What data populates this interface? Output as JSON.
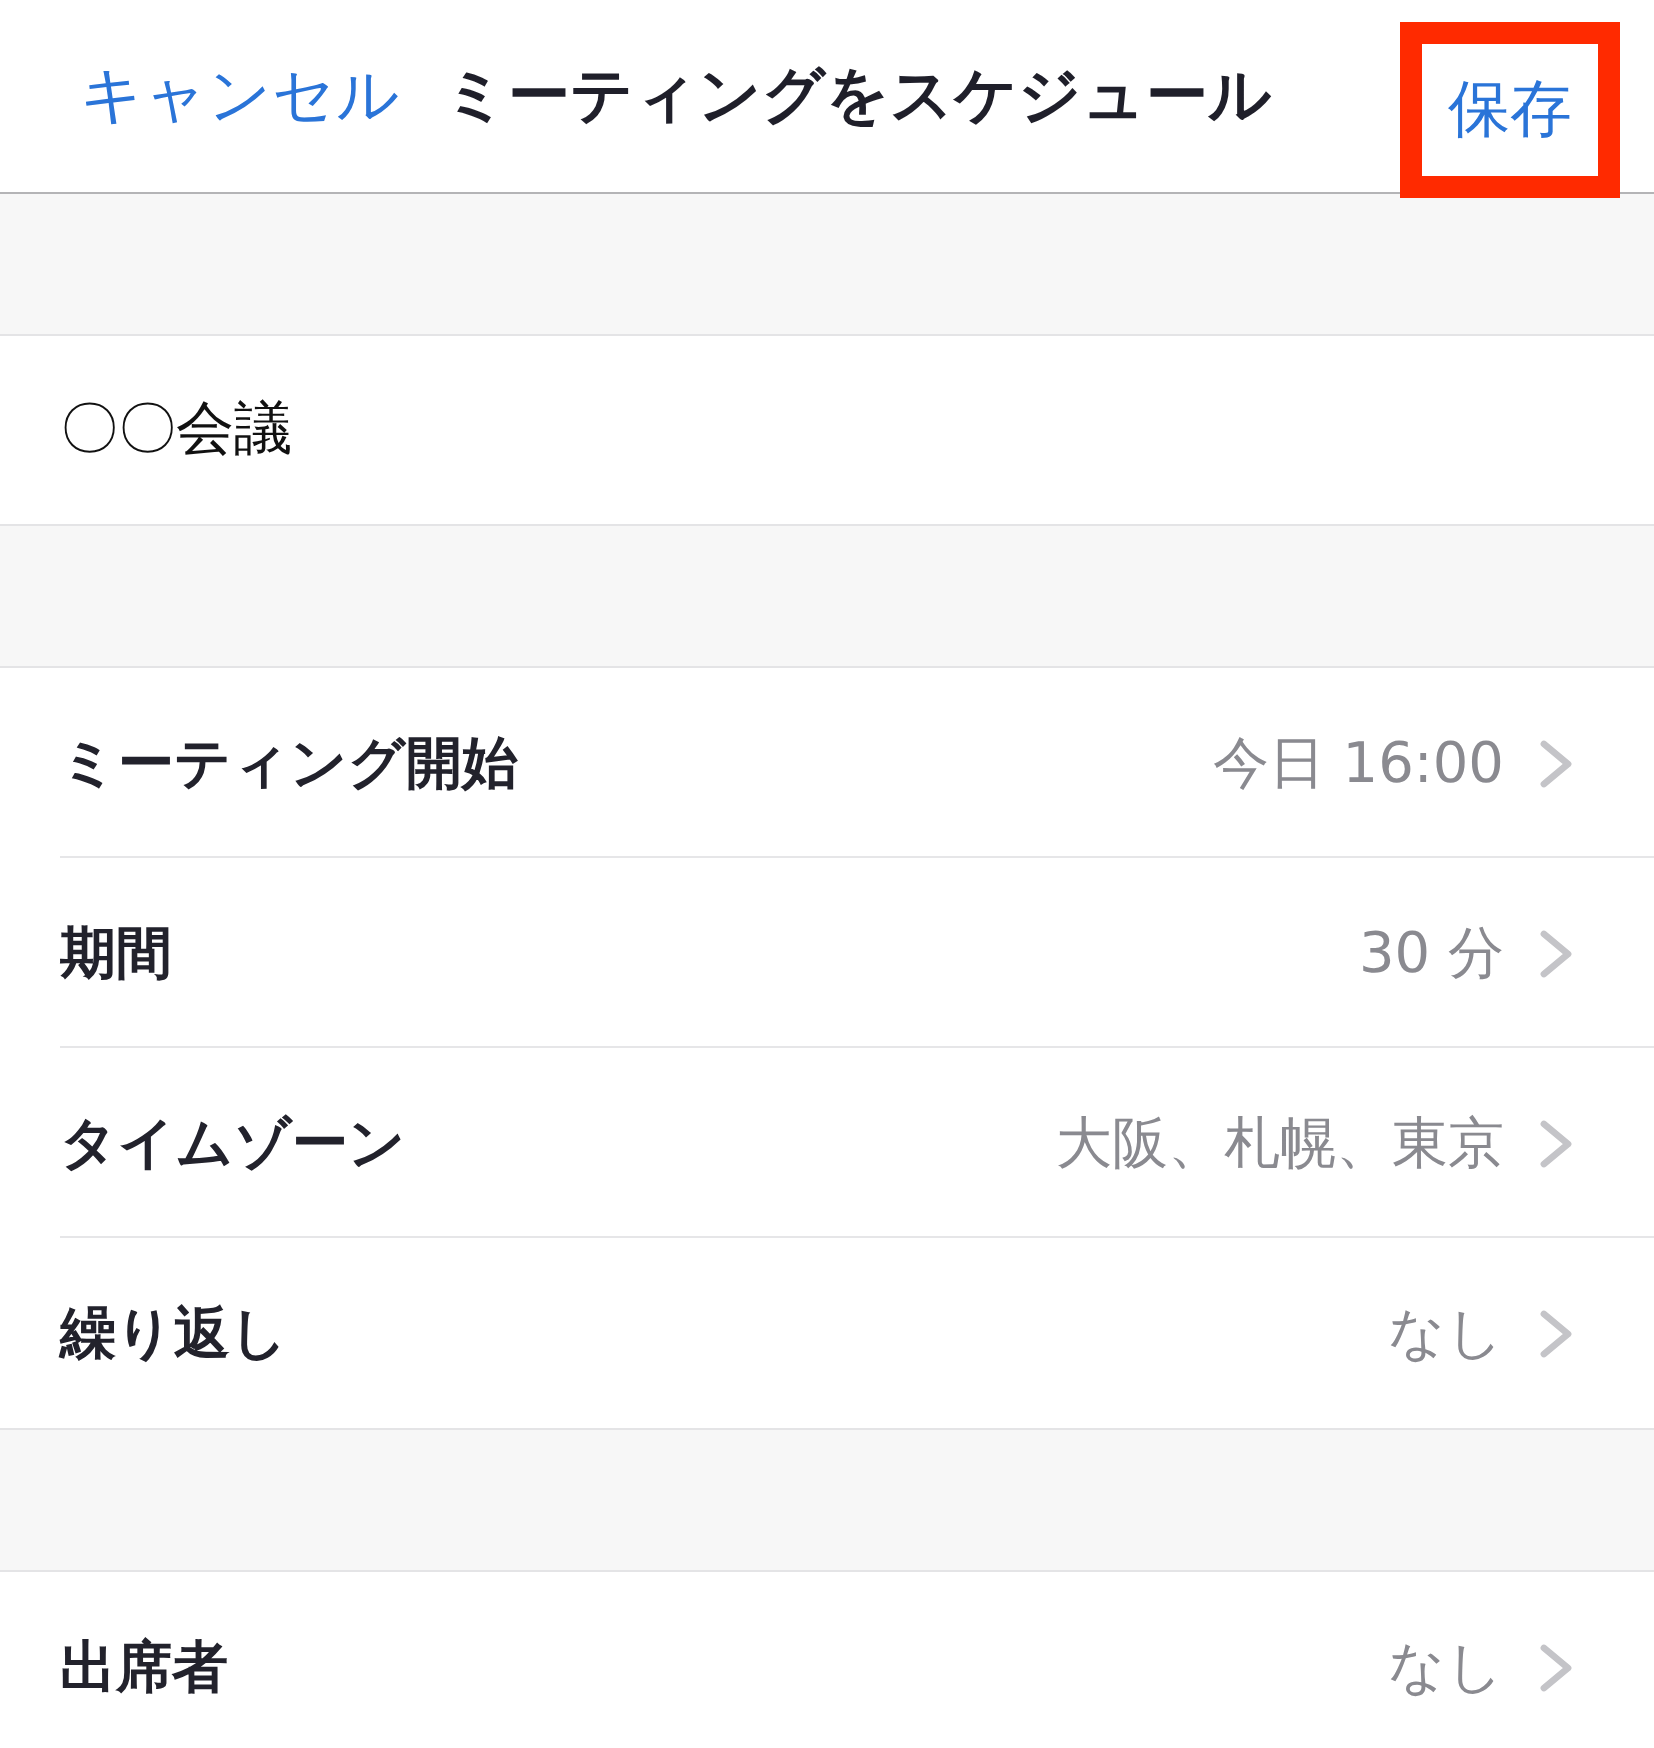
{
  "header": {
    "cancel_button": "キャンセル",
    "title": "ミーティングをスケジュール",
    "save_button": {
      "label": "保存",
      "highlighted": true
    }
  },
  "topic": {
    "value": "〇〇会議"
  },
  "sections": [
    {
      "rows": [
        {
          "label": "ミーティング開始",
          "value": "今日 16:00"
        },
        {
          "label": "期間",
          "value": "30 分"
        },
        {
          "label": "タイムゾーン",
          "value": "大阪、札幌、東京"
        },
        {
          "label": "繰り返し",
          "value": "なし"
        }
      ]
    },
    {
      "rows": [
        {
          "label": "出席者",
          "value": "なし"
        }
      ]
    }
  ]
}
